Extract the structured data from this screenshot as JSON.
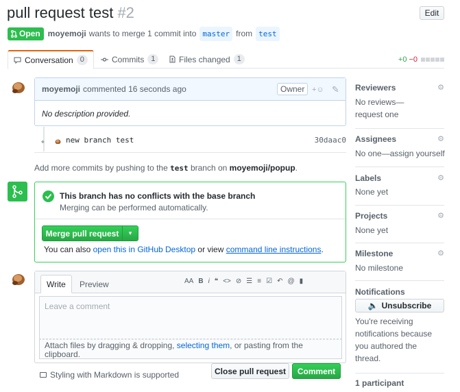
{
  "header": {
    "title": "pull request test",
    "number": "#2",
    "edit_label": "Edit"
  },
  "meta": {
    "state": "Open",
    "author": "moyemoji",
    "text1": "wants to merge 1 commit into",
    "base": "master",
    "text2": "from",
    "head": "test"
  },
  "tabs": [
    {
      "label": "Conversation",
      "count": "0"
    },
    {
      "label": "Commits",
      "count": "1"
    },
    {
      "label": "Files changed",
      "count": "1"
    }
  ],
  "diffstat": {
    "additions": "+0",
    "deletions": "−0"
  },
  "comment": {
    "author": "moyemoji",
    "action": "commented",
    "time": "16 seconds ago",
    "badge": "Owner",
    "body": "No description provided."
  },
  "commit": {
    "message": "new branch test",
    "sha": "30daac0"
  },
  "hint": {
    "prefix": "Add more commits by pushing to the",
    "branch": "test",
    "middle": "branch on",
    "repo": "moyemoji/popup",
    "suffix": "."
  },
  "merge": {
    "title": "This branch has no conflicts with the base branch",
    "subtitle": "Merging can be performed automatically.",
    "button": "Merge pull request",
    "alt_prefix": "You can also",
    "alt_link1": "open this in GitHub Desktop",
    "alt_middle": "or view",
    "alt_link2": "command line instructions",
    "alt_suffix": "."
  },
  "editor": {
    "tab_write": "Write",
    "tab_preview": "Preview",
    "placeholder": "Leave a comment",
    "attach_prefix": "Attach files by dragging & dropping,",
    "attach_link": "selecting them",
    "attach_suffix": ", or pasting from the clipboard.",
    "markdown_note": "Styling with Markdown is supported",
    "close_button": "Close pull request",
    "comment_button": "Comment"
  },
  "toolbar": [
    "AA",
    "B",
    "i",
    "❝",
    "<>",
    "⊘",
    "☰",
    "≡",
    "☑",
    "↶",
    "@",
    "▮"
  ],
  "sidebar": {
    "reviewers": {
      "title": "Reviewers",
      "value1": "No reviews—",
      "value2": "request one"
    },
    "assignees": {
      "title": "Assignees",
      "value": "No one—assign yourself"
    },
    "labels": {
      "title": "Labels",
      "value": "None yet"
    },
    "projects": {
      "title": "Projects",
      "value": "None yet"
    },
    "milestone": {
      "title": "Milestone",
      "value": "No milestone"
    },
    "notifications": {
      "title": "Notifications",
      "button": "Unsubscribe",
      "line1": "You're receiving",
      "line2": "notifications because",
      "line3": "you authored the",
      "line4": "thread."
    },
    "participants": "1 participant"
  },
  "colors": {
    "open_green": "#2cbe4e",
    "link_blue": "#0366d6",
    "tab_accent": "#e36209"
  }
}
